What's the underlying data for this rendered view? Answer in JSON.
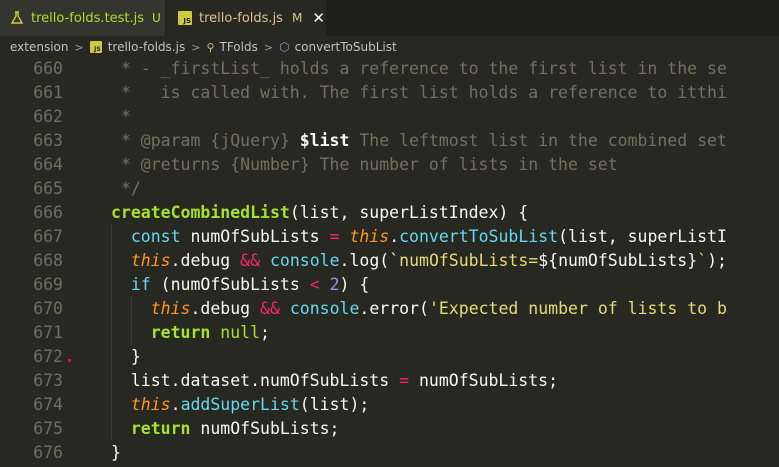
{
  "tabs": [
    {
      "label": "trello-folds.test.js",
      "badge": "U",
      "icon": "flask-icon"
    },
    {
      "label": "trello-folds.js",
      "badge": "M",
      "icon": "js-icon",
      "close": "✕"
    }
  ],
  "breadcrumb": {
    "items": [
      "extension",
      "trello-folds.js",
      "TFolds",
      "convertToSubList"
    ],
    "separator": ">"
  },
  "editor": {
    "lines": [
      {
        "n": "660",
        "parts": [
          [
            "c-comment",
            " * - _firstList_ holds a reference to the first list in the se"
          ]
        ]
      },
      {
        "n": "661",
        "parts": [
          [
            "c-comment",
            " *   is called with. The first list holds a reference to itthi"
          ]
        ]
      },
      {
        "n": "662",
        "parts": [
          [
            "c-comment",
            " *"
          ]
        ]
      },
      {
        "n": "663",
        "parts": [
          [
            "c-comment",
            " * @param {jQuery} "
          ],
          [
            "c-doc-param",
            "$list"
          ],
          [
            "c-comment",
            " The leftmost list in the combined set"
          ]
        ]
      },
      {
        "n": "664",
        "parts": [
          [
            "c-comment",
            " * @returns {Number} The number of lists in the set"
          ]
        ]
      },
      {
        "n": "665",
        "parts": [
          [
            "c-comment",
            " */"
          ]
        ]
      },
      {
        "n": "666",
        "parts": [
          [
            "c-fn c-bold",
            "createCombinedList"
          ],
          [
            "c-plain",
            "(list, superListIndex) {"
          ]
        ]
      },
      {
        "n": "667",
        "parts": [
          [
            "c-plain",
            "  "
          ],
          [
            "c-kw",
            "const"
          ],
          [
            "c-plain",
            " numOfSubLists "
          ],
          [
            "c-op",
            "="
          ],
          [
            "c-plain",
            " "
          ],
          [
            "c-this",
            "this"
          ],
          [
            "c-plain",
            "."
          ],
          [
            "c-method",
            "convertToSubList"
          ],
          [
            "c-plain",
            "(list, superListI"
          ]
        ]
      },
      {
        "n": "668",
        "parts": [
          [
            "c-plain",
            "  "
          ],
          [
            "c-this",
            "this"
          ],
          [
            "c-plain",
            ".debug "
          ],
          [
            "c-op",
            "&&"
          ],
          [
            "c-plain",
            " "
          ],
          [
            "c-console",
            "console"
          ],
          [
            "c-plain",
            ".log(`"
          ],
          [
            "c-str",
            "numOfSubLists="
          ],
          [
            "c-plain",
            "${numOfSubLists}"
          ],
          [
            "c-str",
            "`"
          ],
          [
            "c-plain",
            ");"
          ]
        ]
      },
      {
        "n": "669",
        "parts": [
          [
            "c-plain",
            "  "
          ],
          [
            "c-kw",
            "if"
          ],
          [
            "c-plain",
            " (numOfSubLists "
          ],
          [
            "c-op",
            "<"
          ],
          [
            "c-plain",
            " "
          ],
          [
            "c-num",
            "2"
          ],
          [
            "c-plain",
            ") {"
          ]
        ]
      },
      {
        "n": "670",
        "parts": [
          [
            "c-plain",
            "    "
          ],
          [
            "c-this",
            "this"
          ],
          [
            "c-plain",
            ".debug "
          ],
          [
            "c-op",
            "&&"
          ],
          [
            "c-plain",
            " "
          ],
          [
            "c-console",
            "console"
          ],
          [
            "c-plain",
            ".error("
          ],
          [
            "c-str",
            "'Expected number of lists to b"
          ]
        ]
      },
      {
        "n": "671",
        "parts": [
          [
            "c-plain",
            "    "
          ],
          [
            "c-fn c-bold",
            "return"
          ],
          [
            "c-plain",
            " "
          ],
          [
            "c-fn",
            "null"
          ],
          [
            "c-plain",
            ";"
          ]
        ]
      },
      {
        "n": "672",
        "parts": [
          [
            "c-plain",
            "  }"
          ]
        ]
      },
      {
        "n": "673",
        "parts": [
          [
            "c-plain",
            "  list.dataset.numOfSubLists "
          ],
          [
            "c-op",
            "="
          ],
          [
            "c-plain",
            " numOfSubLists;"
          ]
        ]
      },
      {
        "n": "674",
        "parts": [
          [
            "c-plain",
            "  "
          ],
          [
            "c-this",
            "this"
          ],
          [
            "c-plain",
            "."
          ],
          [
            "c-method",
            "addSuperList"
          ],
          [
            "c-plain",
            "(list);"
          ]
        ]
      },
      {
        "n": "675",
        "parts": [
          [
            "c-plain",
            "  "
          ],
          [
            "c-fn c-bold",
            "return"
          ],
          [
            "c-plain",
            " numOfSubLists;"
          ]
        ]
      },
      {
        "n": "676",
        "parts": [
          [
            "c-plain",
            "}"
          ]
        ]
      }
    ]
  },
  "colors": {
    "background": "#272822",
    "tab_active_label": "#e2c08d",
    "tab_untracked_label": "#a6e22e",
    "line_number": "#6f705e",
    "comment": "#75715e",
    "keyword": "#66d9ef",
    "function": "#a6e22e",
    "operator": "#f92672",
    "number": "#ae81ff",
    "string": "#e6db74",
    "this": "#fd971f"
  }
}
